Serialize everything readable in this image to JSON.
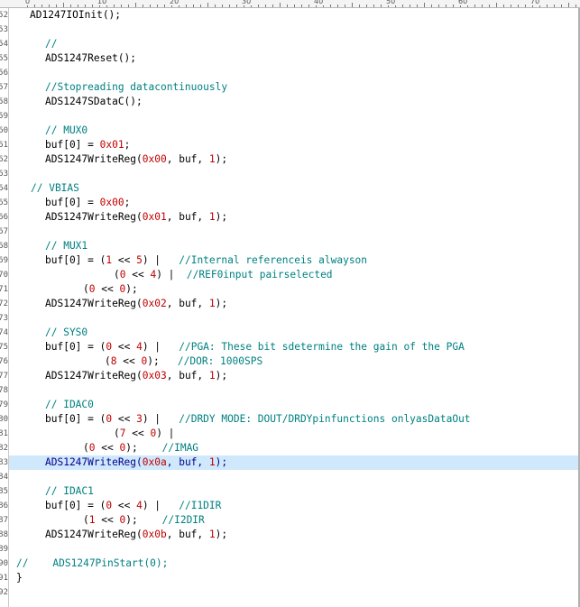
{
  "editor": {
    "current_line": 83,
    "colors": {
      "background": "#ffffff",
      "text": "#000000",
      "comment": "#008080",
      "number": "#c00000",
      "current_line_highlight": "#cfe8fc",
      "current_line_text": "#00008b"
    }
  },
  "ruler": {
    "labels": [
      "0",
      "10",
      "20",
      "30",
      "40",
      "50",
      "60",
      "70"
    ]
  },
  "lines": [
    {
      "num": "52",
      "tokens": [
        {
          "t": "AD1247IOInit();",
          "k": "plain"
        }
      ]
    },
    {
      "num": "53",
      "tokens": []
    },
    {
      "num": "54",
      "tokens": [
        {
          "t": "//",
          "k": "comment"
        }
      ]
    },
    {
      "num": "55",
      "tokens": [
        {
          "t": "ADS1247Reset();",
          "k": "plain"
        }
      ]
    },
    {
      "num": "56",
      "tokens": []
    },
    {
      "num": "57",
      "tokens": [
        {
          "t": "//Stopreading datacontinuously",
          "k": "comment"
        }
      ]
    },
    {
      "num": "58",
      "tokens": [
        {
          "t": "ADS1247SDataC();",
          "k": "plain"
        }
      ]
    },
    {
      "num": "59",
      "tokens": []
    },
    {
      "num": "60",
      "tokens": [
        {
          "t": "// MUX0",
          "k": "comment"
        }
      ]
    },
    {
      "num": "61",
      "tokens": [
        {
          "t": "buf[0] = ",
          "k": "plain"
        },
        {
          "t": "0x01",
          "k": "number"
        },
        {
          "t": ";",
          "k": "plain"
        }
      ]
    },
    {
      "num": "62",
      "tokens": [
        {
          "t": "ADS1247WriteReg(",
          "k": "plain"
        },
        {
          "t": "0x00",
          "k": "number"
        },
        {
          "t": ", buf, ",
          "k": "plain"
        },
        {
          "t": "1",
          "k": "number"
        },
        {
          "t": ");",
          "k": "plain"
        }
      ]
    },
    {
      "num": "63",
      "tokens": []
    },
    {
      "num": "64",
      "tokens": [
        {
          "t": "// VBIAS",
          "k": "comment"
        }
      ]
    },
    {
      "num": "65",
      "tokens": [
        {
          "t": "buf[0] = ",
          "k": "plain"
        },
        {
          "t": "0x00",
          "k": "number"
        },
        {
          "t": ";",
          "k": "plain"
        }
      ]
    },
    {
      "num": "66",
      "tokens": [
        {
          "t": "ADS1247WriteReg(",
          "k": "plain"
        },
        {
          "t": "0x01",
          "k": "number"
        },
        {
          "t": ", buf, ",
          "k": "plain"
        },
        {
          "t": "1",
          "k": "number"
        },
        {
          "t": ");",
          "k": "plain"
        }
      ]
    },
    {
      "num": "67",
      "tokens": []
    },
    {
      "num": "68",
      "tokens": [
        {
          "t": "// MUX1",
          "k": "comment"
        }
      ]
    },
    {
      "num": "69",
      "tokens": [
        {
          "t": "buf[0] = (",
          "k": "plain"
        },
        {
          "t": "1",
          "k": "number"
        },
        {
          "t": " << ",
          "k": "plain"
        },
        {
          "t": "5",
          "k": "number"
        },
        {
          "t": ") |   ",
          "k": "plain"
        },
        {
          "t": "//Internal referenceis alwayson",
          "k": "comment"
        }
      ]
    },
    {
      "num": "70",
      "tokens": [
        {
          "t": "(",
          "k": "plain"
        },
        {
          "t": "0",
          "k": "number"
        },
        {
          "t": " << ",
          "k": "plain"
        },
        {
          "t": "4",
          "k": "number"
        },
        {
          "t": ") |  ",
          "k": "plain"
        },
        {
          "t": "//REF0input pairselected",
          "k": "comment"
        }
      ]
    },
    {
      "num": "71",
      "tokens": [
        {
          "t": "(",
          "k": "plain"
        },
        {
          "t": "0",
          "k": "number"
        },
        {
          "t": " << ",
          "k": "plain"
        },
        {
          "t": "0",
          "k": "number"
        },
        {
          "t": ");",
          "k": "plain"
        }
      ]
    },
    {
      "num": "72",
      "tokens": [
        {
          "t": "ADS1247WriteReg(",
          "k": "plain"
        },
        {
          "t": "0x02",
          "k": "number"
        },
        {
          "t": ", buf, ",
          "k": "plain"
        },
        {
          "t": "1",
          "k": "number"
        },
        {
          "t": ");",
          "k": "plain"
        }
      ]
    },
    {
      "num": "73",
      "tokens": []
    },
    {
      "num": "74",
      "tokens": [
        {
          "t": "// SYS0",
          "k": "comment"
        }
      ]
    },
    {
      "num": "75",
      "tokens": [
        {
          "t": "buf[0] = (",
          "k": "plain"
        },
        {
          "t": "0",
          "k": "number"
        },
        {
          "t": " << ",
          "k": "plain"
        },
        {
          "t": "4",
          "k": "number"
        },
        {
          "t": ") |   ",
          "k": "plain"
        },
        {
          "t": "//PGA: These bit sdetermine the gain of the PGA",
          "k": "comment"
        }
      ]
    },
    {
      "num": "76",
      "tokens": [
        {
          "t": "(",
          "k": "plain"
        },
        {
          "t": "8",
          "k": "number"
        },
        {
          "t": " << ",
          "k": "plain"
        },
        {
          "t": "0",
          "k": "number"
        },
        {
          "t": ");   ",
          "k": "plain"
        },
        {
          "t": "//DOR: 1000SPS",
          "k": "comment"
        }
      ]
    },
    {
      "num": "77",
      "tokens": [
        {
          "t": "ADS1247WriteReg(",
          "k": "plain"
        },
        {
          "t": "0x03",
          "k": "number"
        },
        {
          "t": ", buf, ",
          "k": "plain"
        },
        {
          "t": "1",
          "k": "number"
        },
        {
          "t": ");",
          "k": "plain"
        }
      ]
    },
    {
      "num": "78",
      "tokens": []
    },
    {
      "num": "79",
      "tokens": [
        {
          "t": "// IDAC0",
          "k": "comment"
        }
      ]
    },
    {
      "num": "80",
      "tokens": [
        {
          "t": "buf[0] = (",
          "k": "plain"
        },
        {
          "t": "0",
          "k": "number"
        },
        {
          "t": " << ",
          "k": "plain"
        },
        {
          "t": "3",
          "k": "number"
        },
        {
          "t": ") |   ",
          "k": "plain"
        },
        {
          "t": "//DRDY MODE: DOUT/DRDYpinfunctions onlyasDataOut",
          "k": "comment"
        }
      ]
    },
    {
      "num": "81",
      "tokens": [
        {
          "t": "(",
          "k": "plain"
        },
        {
          "t": "7",
          "k": "number"
        },
        {
          "t": " << ",
          "k": "plain"
        },
        {
          "t": "0",
          "k": "number"
        },
        {
          "t": ") |",
          "k": "plain"
        }
      ]
    },
    {
      "num": "82",
      "tokens": [
        {
          "t": "(",
          "k": "plain"
        },
        {
          "t": "0",
          "k": "number"
        },
        {
          "t": " << ",
          "k": "plain"
        },
        {
          "t": "0",
          "k": "number"
        },
        {
          "t": ");    ",
          "k": "plain"
        },
        {
          "t": "//IMAG",
          "k": "comment"
        }
      ]
    },
    {
      "num": "83",
      "tokens": [
        {
          "t": "ADS1247WriteReg(",
          "k": "plain"
        },
        {
          "t": "0x0a",
          "k": "number"
        },
        {
          "t": ", buf, ",
          "k": "plain"
        },
        {
          "t": "1",
          "k": "number"
        },
        {
          "t": ");",
          "k": "plain"
        }
      ]
    },
    {
      "num": "84",
      "tokens": []
    },
    {
      "num": "85",
      "tokens": [
        {
          "t": "// IDAC1",
          "k": "comment"
        }
      ]
    },
    {
      "num": "86",
      "tokens": [
        {
          "t": "buf[0] = (",
          "k": "plain"
        },
        {
          "t": "0",
          "k": "number"
        },
        {
          "t": " << ",
          "k": "plain"
        },
        {
          "t": "4",
          "k": "number"
        },
        {
          "t": ") |   ",
          "k": "plain"
        },
        {
          "t": "//I1DIR",
          "k": "comment"
        }
      ]
    },
    {
      "num": "87",
      "tokens": [
        {
          "t": "(",
          "k": "plain"
        },
        {
          "t": "1",
          "k": "number"
        },
        {
          "t": " << ",
          "k": "plain"
        },
        {
          "t": "0",
          "k": "number"
        },
        {
          "t": ");    ",
          "k": "plain"
        },
        {
          "t": "//I2DIR",
          "k": "comment"
        }
      ]
    },
    {
      "num": "88",
      "tokens": [
        {
          "t": "ADS1247WriteReg(",
          "k": "plain"
        },
        {
          "t": "0x0b",
          "k": "number"
        },
        {
          "t": ", buf, ",
          "k": "plain"
        },
        {
          "t": "1",
          "k": "number"
        },
        {
          "t": ");",
          "k": "plain"
        }
      ]
    },
    {
      "num": "89",
      "tokens": []
    },
    {
      "num": "90",
      "tokens": [
        {
          "t": "//    ADS1247PinStart(0);",
          "k": "comment"
        }
      ]
    },
    {
      "num": "91",
      "tokens": [
        {
          "t": "}",
          "k": "plain"
        }
      ]
    },
    {
      "num": "92",
      "tokens": []
    }
  ]
}
